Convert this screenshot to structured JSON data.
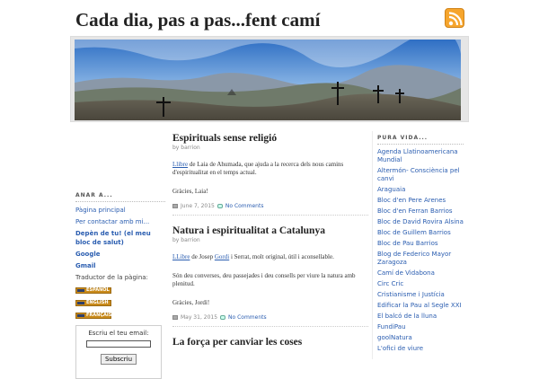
{
  "site": {
    "title": "Cada dia, pas a pas...fent camí"
  },
  "icons": {
    "rss": "rss-feed-icon",
    "calendar": "calendar-icon",
    "comment": "comment-icon"
  },
  "colors": {
    "link": "#2a5db0",
    "rss": "#f6a52d"
  },
  "sidebar_left": {
    "heading": "ANAR A...",
    "links": [
      {
        "label": "Pàgina principal",
        "bold": false
      },
      {
        "label": "Per contactar amb mi...",
        "bold": false
      },
      {
        "label": "Depèn de tu! (el meu bloc de salut)",
        "bold": true
      },
      {
        "label": "Google",
        "bold": true
      },
      {
        "label": "Gmail",
        "bold": true
      }
    ],
    "translator_label": "Traductor de la pàgina:",
    "languages": [
      "ESPAÑOL",
      "ENGLISH",
      "FRANÇAIS"
    ],
    "email_label": "Escriu el teu email:",
    "email_placeholder": "",
    "subscribe_label": "Subscriu"
  },
  "posts": [
    {
      "title": "Espirituals sense religió",
      "author": "by barrion",
      "link_text": "Llibre",
      "body_after_link": " de Laia de Ahumada, que ajuda a  la recerca dels nous camins d'espiritualitat en el temps actual.",
      "paragraph2": "Gràcies, Laia!",
      "date": "June 7, 2015",
      "comments": "No Comments"
    },
    {
      "title": "Natura i espiritualitat a Catalunya",
      "author": "by barrion",
      "link_text": "LLibre",
      "body_mid": " de Josep ",
      "link2_text": "Gordi",
      "body_after_link": " i Serrat, molt original, útil i aconsellable.",
      "paragraph2": "Són deu converses, deu passejades i deu consells per viure la natura amb plenitud.",
      "paragraph3": "Gràcies, Jordi!",
      "date": "May 31, 2015",
      "comments": "No Comments"
    },
    {
      "title": "La força per canviar les coses"
    }
  ],
  "sidebar_right": {
    "heading": "PURA VIDA...",
    "links": [
      "Agenda Llatinoamericana Mundial",
      "Altermón- Consciència pel canvi",
      "Araguaia",
      "Bloc d'en Pere Arenes",
      "Bloc d'en Ferran Barrios",
      "Bloc de David Rovira Alsina",
      "Bloc de Guillem Barrios",
      "Bloc de Pau Barrios",
      "Blog de Federico Mayor Zaragoza",
      "Camí de Vidabona",
      "Circ Cric",
      "Cristianisme i Justícia",
      "Edificar la Pau al Segle XXI",
      "El balcó de la lluna",
      "FundiPau",
      "goolNatura",
      "L'ofici de viure"
    ]
  }
}
